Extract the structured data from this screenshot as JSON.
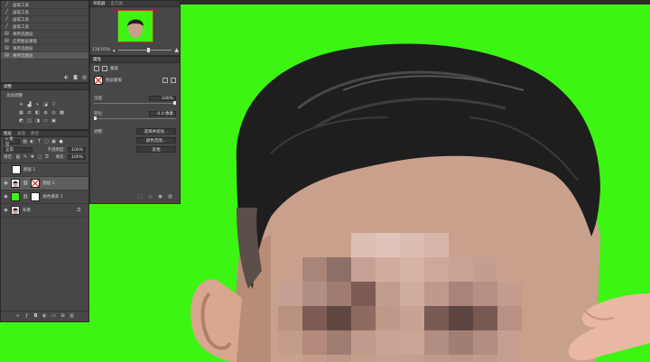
{
  "colors": {
    "green_screen": "#3df513",
    "panel_bg": "#474747",
    "panel_header": "#393939",
    "selected_row": "#5e5e5e"
  },
  "history": {
    "items": [
      {
        "label": "画笔工具",
        "icon": "brush-icon"
      },
      {
        "label": "画笔工具",
        "icon": "brush-icon"
      },
      {
        "label": "画笔工具",
        "icon": "brush-icon"
      },
      {
        "label": "画笔工具",
        "icon": "brush-icon"
      },
      {
        "label": "将所选图层",
        "icon": "layer-doc-icon"
      },
      {
        "label": "应用图层蒙版",
        "icon": "layer-doc-icon"
      },
      {
        "label": "将所选图层",
        "icon": "layer-doc-icon"
      },
      {
        "label": "将所选图层",
        "icon": "layer-doc-icon"
      }
    ]
  },
  "navigator": {
    "tabs": [
      "导航器",
      "直方图"
    ],
    "zoom": "116.05%"
  },
  "properties": {
    "tab": "属性",
    "type_label": "蒙版",
    "mask_name": "图层蒙版",
    "density_label": "浓度:",
    "density_value": "100%",
    "feather_label": "羽化:",
    "feather_value": "0.0 像素",
    "adjust_label": "调整:",
    "select_mask_button": "选择并遮住...",
    "color_range_button": "颜色范围...",
    "invert_button": "反相"
  },
  "adjustments": {
    "tab": "调整",
    "add_label": "添加调整"
  },
  "layers": {
    "tabs": [
      "图层",
      "通道",
      "路径"
    ],
    "filter_label": "ρ 类型",
    "blend_mode": "正常",
    "opacity_label": "不透明度:",
    "opacity_value": "100%",
    "lock_label": "锁定:",
    "fill_label": "填充:",
    "fill_value": "100%",
    "items": [
      {
        "name": "图层 1"
      },
      {
        "name": "图层 2"
      },
      {
        "name": "颜色填充 1"
      },
      {
        "name": "背景"
      }
    ]
  }
}
